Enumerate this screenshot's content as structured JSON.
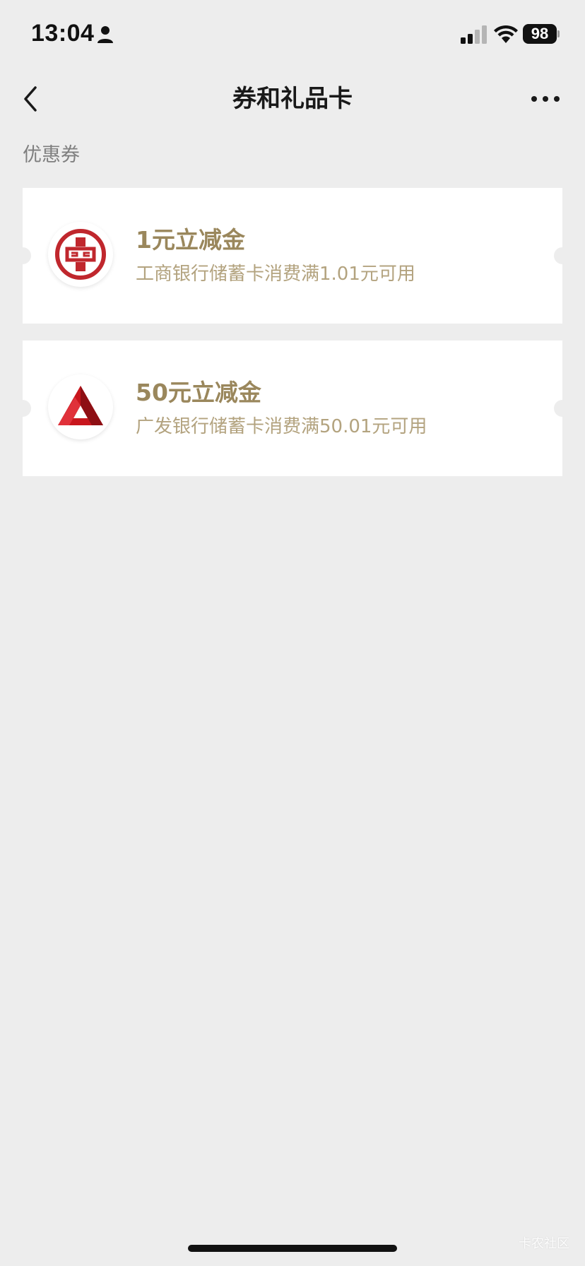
{
  "status_bar": {
    "time": "13:04",
    "battery": "98"
  },
  "nav": {
    "title": "券和礼品卡"
  },
  "section": {
    "label": "优惠券"
  },
  "coupons": [
    {
      "title": "1元立减金",
      "description": "工商银行储蓄卡消费满1.01元可用",
      "logo_icon": "icbc-logo-icon"
    },
    {
      "title": "50元立减金",
      "description": "广发银行储蓄卡消费满50.01元可用",
      "logo_icon": "cgb-logo-icon"
    }
  ],
  "watermark": "卡农社区",
  "colors": {
    "background": "#ededed",
    "card": "#ffffff",
    "coupon_title": "#9a875c",
    "coupon_desc": "#b3a37f",
    "icbc_red": "#c0272d",
    "cgb_red": "#c8161d"
  }
}
